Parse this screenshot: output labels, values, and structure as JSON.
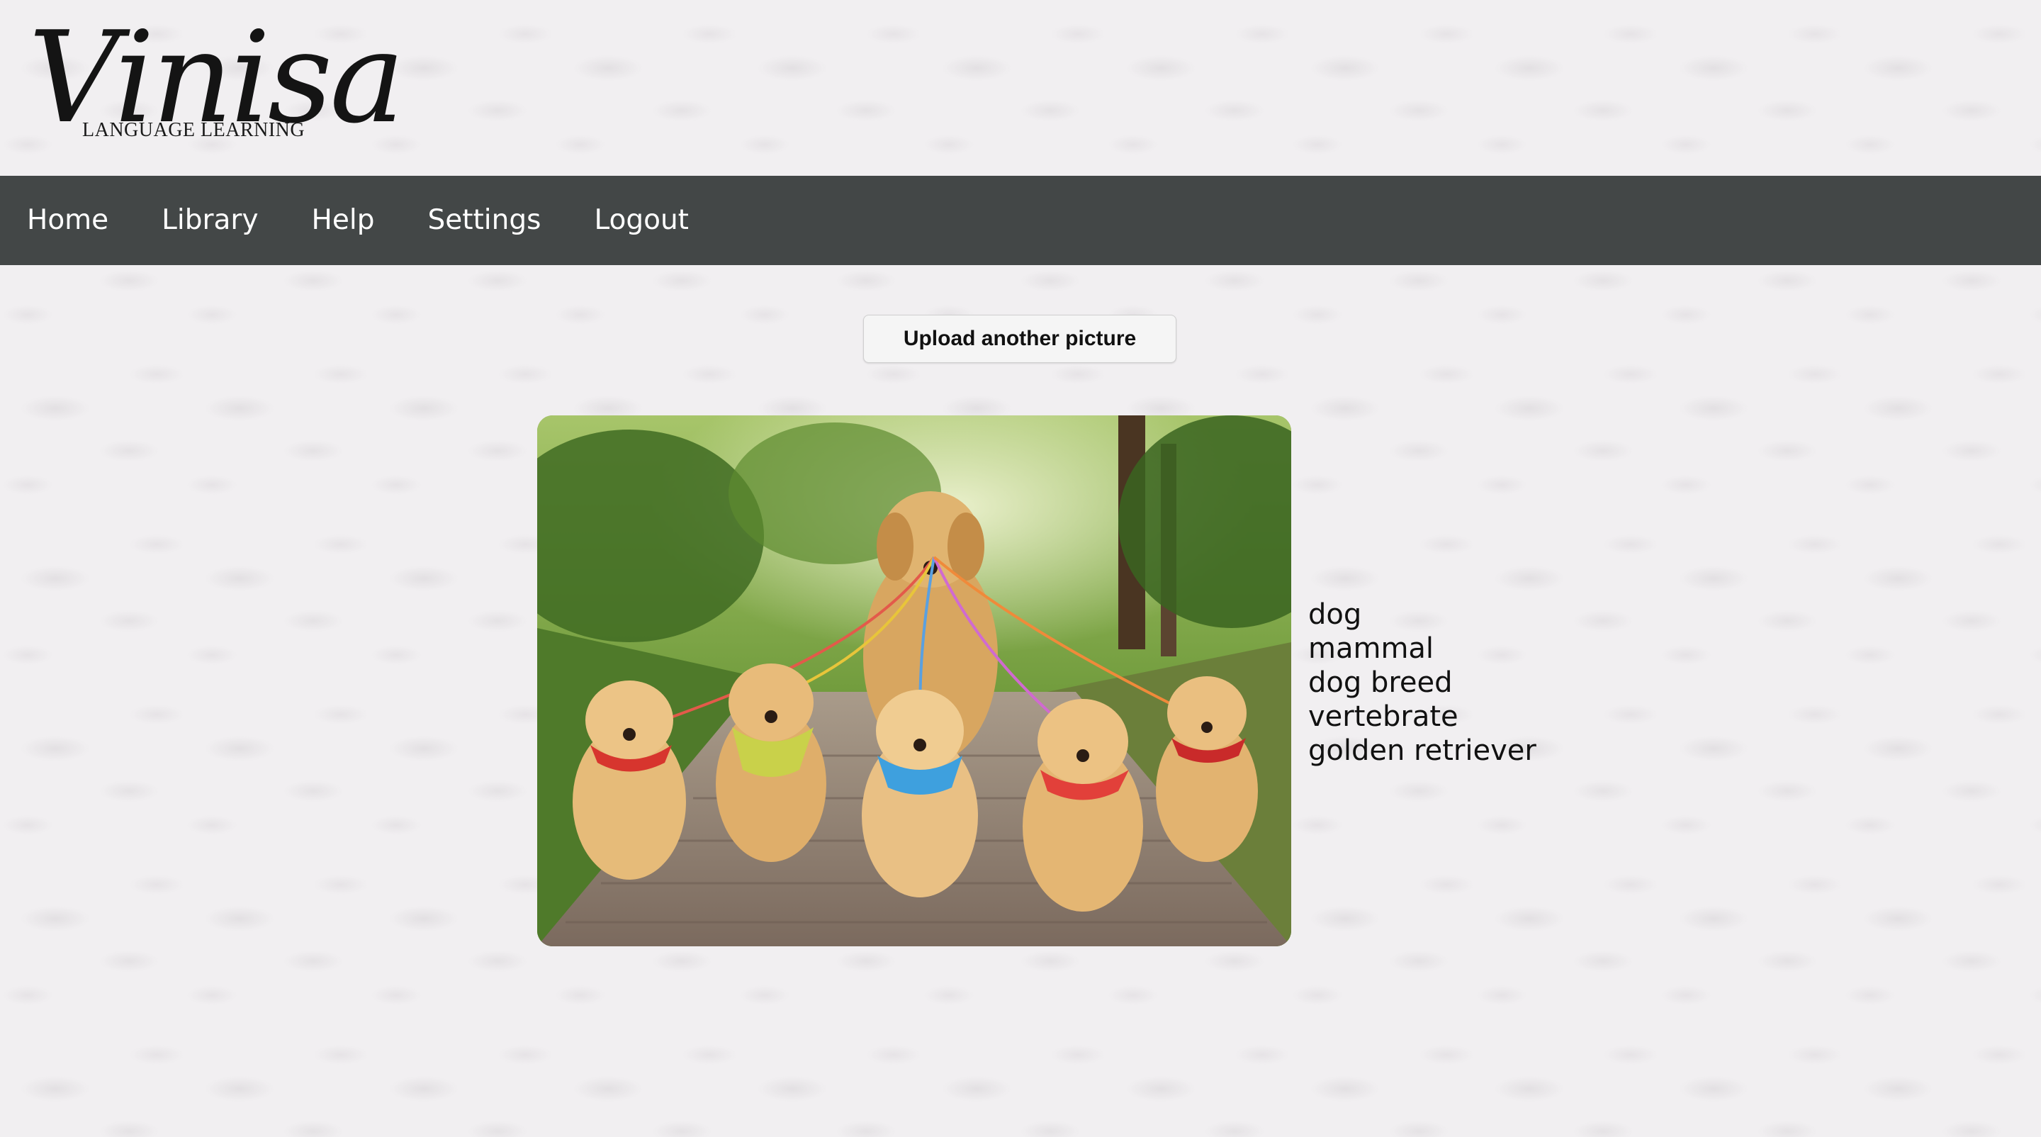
{
  "logo": {
    "script": "Vinisa",
    "subtitle": "LANGUAGE LEARNING"
  },
  "nav": {
    "items": [
      {
        "label": "Home",
        "name": "nav-home"
      },
      {
        "label": "Library",
        "name": "nav-library"
      },
      {
        "label": "Help",
        "name": "nav-help"
      },
      {
        "label": "Settings",
        "name": "nav-settings"
      },
      {
        "label": "Logout",
        "name": "nav-logout"
      }
    ]
  },
  "upload": {
    "label": "Upload another picture"
  },
  "photo": {
    "alt": "golden retriever puppies"
  },
  "labels": [
    "dog",
    "mammal",
    "dog breed",
    "vertebrate",
    "golden retriever"
  ],
  "colors": {
    "navbar": "#434747",
    "nav_text": "#ffffff",
    "background": "#f1eff1"
  }
}
